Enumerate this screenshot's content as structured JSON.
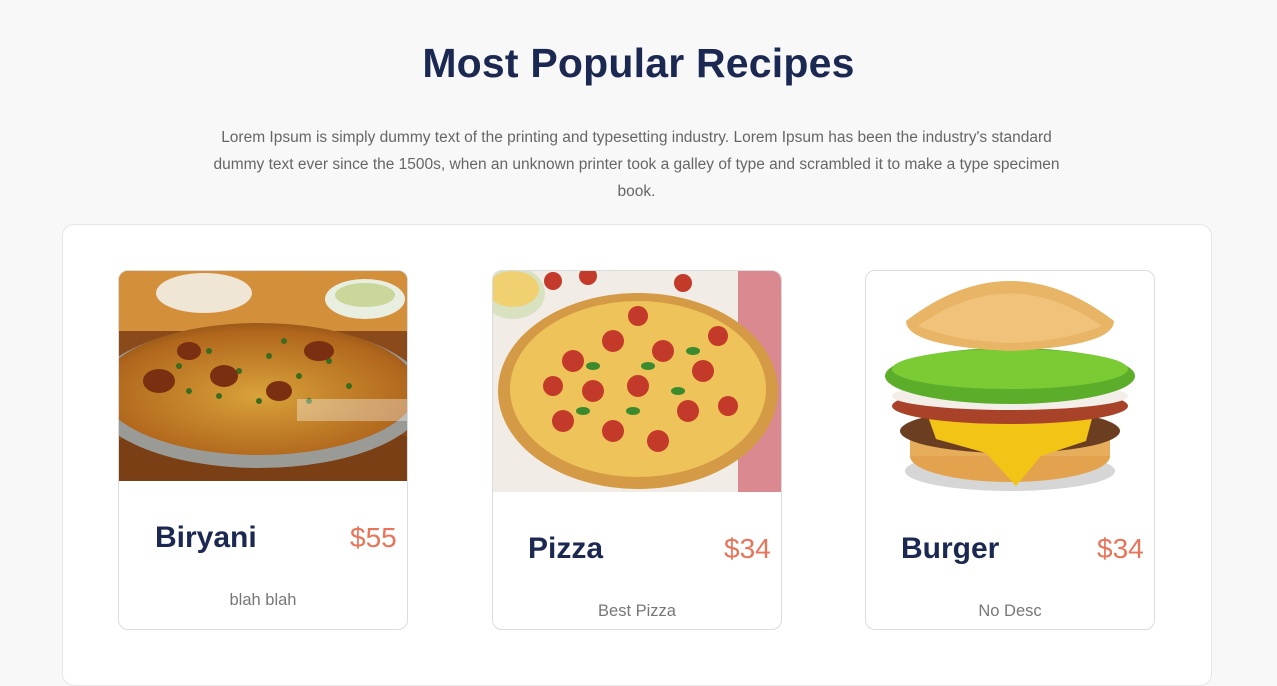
{
  "section": {
    "title": "Most Popular Recipes",
    "description": "Lorem Ipsum is simply dummy text of the printing and typesetting industry. Lorem Ipsum has been the industry's standard dummy text ever since the 1500s, when an unknown printer took a galley of type and scrambled it to make a type specimen book."
  },
  "recipes": [
    {
      "name": "Biryani",
      "price": "$55",
      "description": "blah blah",
      "image": "biryani-photo"
    },
    {
      "name": "Pizza",
      "price": "$34",
      "description": "Best Pizza",
      "image": "pizza-photo"
    },
    {
      "name": "Burger",
      "price": "$34",
      "description": "No Desc",
      "image": "burger-photo"
    }
  ],
  "colors": {
    "heading": "#1b2952",
    "price": "#e8745a",
    "body_text": "#666666",
    "background": "#f8f8f8"
  }
}
